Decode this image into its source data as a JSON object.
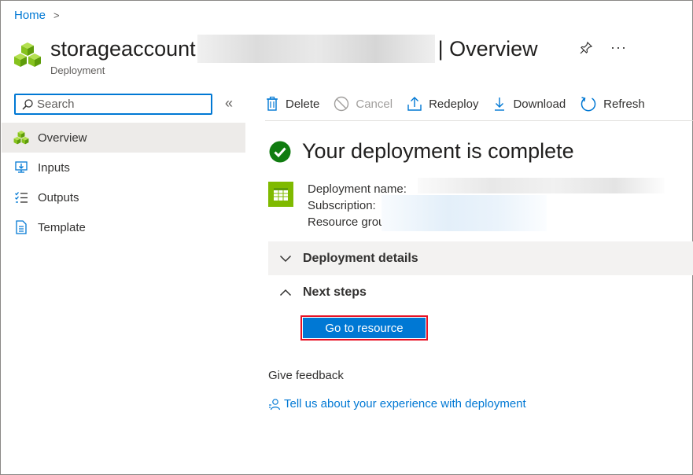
{
  "breadcrumb": {
    "home": "Home",
    "separator": ">"
  },
  "header": {
    "title_name": "storageaccount",
    "title_suffix": "| Overview",
    "subtitle": "Deployment",
    "more": "···"
  },
  "sidebar": {
    "search_placeholder": "Search",
    "collapse": "«",
    "items": [
      {
        "label": "Overview",
        "icon": "cubes-icon",
        "active": true
      },
      {
        "label": "Inputs",
        "icon": "inputs-icon",
        "active": false
      },
      {
        "label": "Outputs",
        "icon": "outputs-icon",
        "active": false
      },
      {
        "label": "Template",
        "icon": "template-icon",
        "active": false
      }
    ]
  },
  "toolbar": {
    "delete": "Delete",
    "cancel": "Cancel",
    "redeploy": "Redeploy",
    "download": "Download",
    "refresh": "Refresh"
  },
  "status": {
    "message": "Your deployment is complete",
    "color": "#107c10"
  },
  "deployment": {
    "name_label": "Deployment name:",
    "subscription_label": "Subscription:",
    "resource_group_label": "Resource grou"
  },
  "sections": {
    "details": "Deployment details",
    "next_steps": "Next steps"
  },
  "actions": {
    "go_to_resource": "Go to resource"
  },
  "feedback": {
    "title": "Give feedback",
    "link": "Tell us about your experience with deployment"
  },
  "colors": {
    "accent": "#0078d4",
    "highlight": "#e81123",
    "success": "#107c10",
    "icon_green": "#7fba00"
  }
}
